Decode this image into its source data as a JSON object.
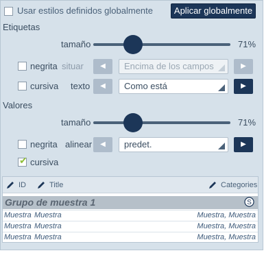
{
  "global": {
    "use_global_label": "Usar estilos definidos globalmente",
    "apply_button": "Aplicar globalmente"
  },
  "labels_section": {
    "title": "Etiquetas",
    "size_label": "tamaño",
    "size_value": "71%",
    "size_fraction": 0.71,
    "bold_label": "negrita",
    "place_label": "situar",
    "place_value": "Encima de los campos",
    "italic_label": "cursiva",
    "text_label": "texto",
    "text_value": "Como está"
  },
  "values_section": {
    "title": "Valores",
    "size_label": "tamaño",
    "size_value": "71%",
    "size_fraction": 0.71,
    "bold_label": "negrita",
    "align_label": "alinear",
    "align_value": "predet.",
    "italic_label": "cursiva",
    "italic_checked": true
  },
  "preview": {
    "columns": [
      "ID",
      "Title",
      "Categories"
    ],
    "group_title": "Grupo de muestra 1",
    "rows": [
      [
        "Muestra",
        "Muestra",
        "Muestra, Muestra"
      ],
      [
        "Muestra",
        "Muestra",
        "Muestra, Muestra"
      ],
      [
        "Muestra",
        "Muestra",
        "Muestra, Muestra"
      ]
    ]
  },
  "colors": {
    "panel_bg": "#d6e1ea",
    "accent": "#1c3658",
    "checkmark": "#8fbf3a"
  }
}
